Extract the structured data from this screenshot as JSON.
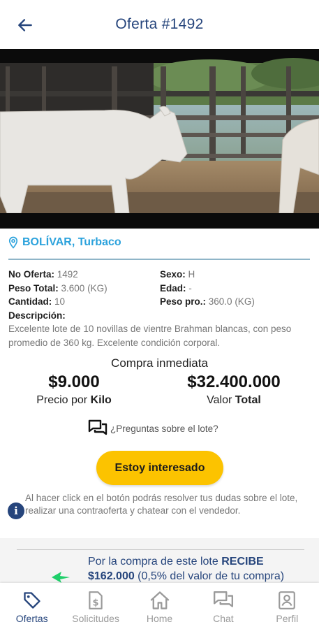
{
  "header": {
    "title": "Oferta #1492",
    "back_icon": "arrow-left-icon"
  },
  "photo": {
    "subject": "cattle-photo"
  },
  "location": {
    "icon": "map-pin-icon",
    "text": "BOLÍVAR, Turbaco",
    "color": "#2ba2dc"
  },
  "details": {
    "no_oferta_label": "No Oferta:",
    "no_oferta_value": "1492",
    "sexo_label": "Sexo:",
    "sexo_value": "H",
    "peso_total_label": "Peso Total:",
    "peso_total_value": "3.600 (KG)",
    "edad_label": "Edad:",
    "edad_value": "-",
    "cantidad_label": "Cantidad:",
    "cantidad_value": "10",
    "peso_pro_label": "Peso pro.:",
    "peso_pro_value": "360.0 (KG)",
    "descripcion_label": "Descripción:",
    "descripcion_value": "Excelente lote de 10 novillas de vientre Brahman blancas, con peso promedio de 360 kg. Excelente condición corporal."
  },
  "pricing": {
    "buy_now_label": "Compra inmediata",
    "price_per_kilo_value": "$9.000",
    "price_per_kilo_label": "Precio por ",
    "price_per_kilo_label_bold": "Kilo",
    "total_value": "$32.400.000",
    "total_label": "Valor ",
    "total_label_bold": "Total"
  },
  "questions": {
    "icon": "chat-bubbles-icon",
    "text": "¿Preguntas sobre el lote?"
  },
  "cta": {
    "label": "Estoy interesado",
    "color": "#fcc300"
  },
  "info_note": {
    "icon": "info-icon",
    "text": "Al hacer click en el botón podrás resolver tus dudas sobre el lote, realizar una contraoferta y chatear con el vendedor."
  },
  "promo": {
    "text_prefix": "Por la compra de este lote ",
    "text_bold": "RECIBE",
    "amount": "$162.000",
    "text_suffix": " (0,5% del valor de tu compra)",
    "icon": "green-arrow-icon"
  },
  "nav": {
    "items": [
      {
        "label": "Ofertas",
        "icon": "tag-icon",
        "active": true
      },
      {
        "label": "Solicitudes",
        "icon": "dollar-document-icon",
        "active": false
      },
      {
        "label": "Home",
        "icon": "home-icon",
        "active": false
      },
      {
        "label": "Chat",
        "icon": "chat-icon",
        "active": false
      },
      {
        "label": "Perfil",
        "icon": "profile-icon",
        "active": false
      }
    ]
  },
  "colors": {
    "primary": "#26457c",
    "accent": "#fcc300",
    "link": "#2ba2dc",
    "muted": "#777777"
  }
}
